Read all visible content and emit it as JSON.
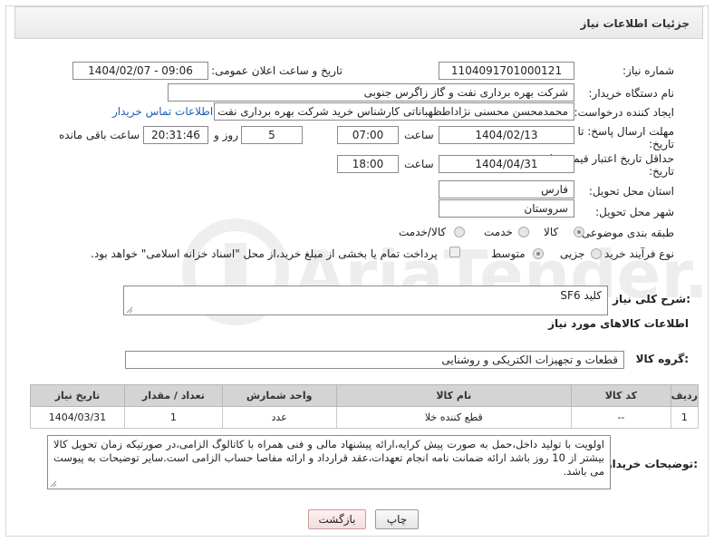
{
  "header": {
    "title": "جزئیات اطلاعات نیاز"
  },
  "fields": {
    "need_number_label": "شماره نیاز:",
    "need_number": "1104091701000121",
    "announce_label": "تاریخ و ساعت اعلان عمومی:",
    "announce_value": "1404/02/07 - 09:06",
    "buyer_org_label": "نام دستگاه خریدار:",
    "buyer_org": "شرکت بهره برداری نفت و گاز زاگرس جنوبی",
    "creator_label": "ایجاد کننده درخواست:",
    "creator": "محمدمحسن محسنی نژاداطظهباناتی کارشناس خرید شرکت بهره برداری نفت و",
    "contact_link": "اطلاعات تماس خریدار",
    "deadline_label": "مهلت ارسال پاسخ: تا تاریخ:",
    "deadline_date": "1404/02/13",
    "time_label": "ساعت",
    "deadline_time": "07:00",
    "days_value": "5",
    "days_label": "روز و",
    "remaining_time": "20:31:46",
    "remaining_label": "ساعت باقی مانده",
    "validity_label": "حداقل تاریخ اعتبار قیمت: تا تاریخ:",
    "validity_date": "1404/04/31",
    "validity_time_label": "ساعت",
    "validity_time": "18:00",
    "province_label": "استان محل تحویل:",
    "province": "فارس",
    "city_label": "شهر محل تحویل:",
    "city": "سروستان",
    "category_label": "طبقه بندی موضوعی:",
    "category_options": [
      "کالا",
      "خدمت",
      "کالا/خدمت"
    ],
    "process_label": "نوع فرآیند خرید :",
    "process_options": [
      "جزیی",
      "متوسط"
    ],
    "payment_note": "پرداخت تمام یا بخشی از مبلغ خرید،از محل \"اسناد خزانه اسلامی\" خواهد بود."
  },
  "description": {
    "label": "شرح کلی نیاز:",
    "value": "کلید SF6"
  },
  "goods_section": {
    "title": "اطلاعات کالاهای مورد نیاز",
    "group_label": "گروه کالا:",
    "group_value": "قطعات و تجهیزات الکتریکی و روشنایی"
  },
  "table": {
    "headers": [
      "ردیف",
      "کد کالا",
      "نام کالا",
      "واحد شمارش",
      "تعداد / مقدار",
      "تاریخ نیاز"
    ],
    "rows": [
      [
        "1",
        "--",
        "قطع کننده خلا",
        "عدد",
        "1",
        "1404/03/31"
      ]
    ]
  },
  "buyer_notes": {
    "label": "توضیحات خریدار:",
    "value": "اولویت با تولید داخل،حمل به صورت پیش کرایه،ارائه پیشنهاد مالی و فنی همراه با کاتالوگ الزامی،در صورتیکه زمان تحویل کالا بیشتر از 10 روز باشد ارائه ضمانت نامه انجام تعهدات،عقد قرارداد و ارائه مفاصا حساب الزامی است.سایر توضیحات به پیوست می باشد."
  },
  "buttons": {
    "print": "چاپ",
    "back": "بازگشت"
  },
  "watermark": {
    "text": "AriaTender.neT"
  },
  "colors": {
    "link": "#1a5fb4",
    "header_bg": "#ececec",
    "table_header": "#d4d4d4",
    "watermark": "#c9c9c9"
  }
}
